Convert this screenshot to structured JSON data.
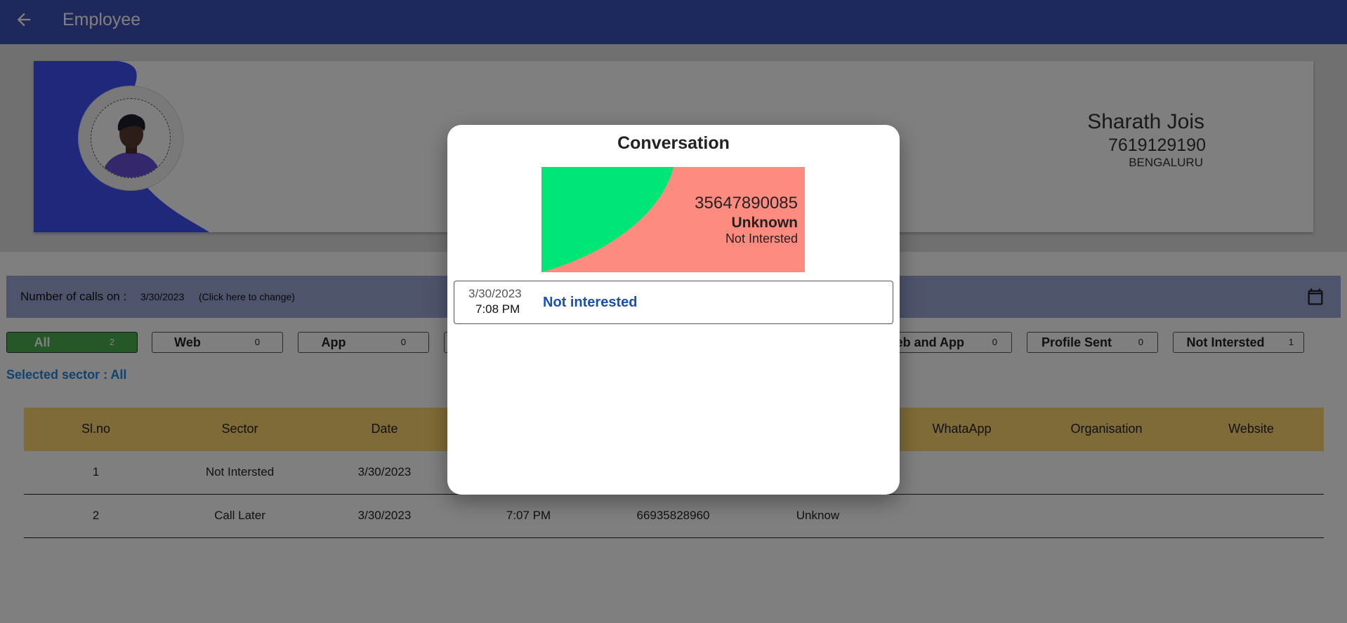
{
  "appbar": {
    "title": "Employee",
    "back_icon": "arrow-left-icon"
  },
  "profile": {
    "name": "Sharath Jois",
    "phone": "7619129190",
    "city": "BENGALURU"
  },
  "date_bar": {
    "label": "Number of calls on :",
    "date": "3/30/2023",
    "change_hint": "(Click here to change)",
    "calendar_icon": "calendar-icon"
  },
  "chips": [
    {
      "label": "All",
      "count": "2",
      "active": true
    },
    {
      "label": "Web",
      "count": "0"
    },
    {
      "label": "App",
      "count": "0"
    },
    {
      "label": "Web and App",
      "count": "0"
    },
    {
      "label": "Profile Sent",
      "count": "0"
    },
    {
      "label": "Not Intersted",
      "count": "1"
    }
  ],
  "selected_sector": "Selected sector : All",
  "table": {
    "headers": [
      "Sl.no",
      "Sector",
      "Date",
      "",
      "",
      "",
      "WhataApp",
      "Organisation",
      "Website"
    ],
    "rows": [
      {
        "slno": "1",
        "sector": "Not Intersted",
        "date": "3/30/2023",
        "time": "",
        "number": "",
        "name": ""
      },
      {
        "slno": "2",
        "sector": "Call Later",
        "date": "3/30/2023",
        "time": "7:07 PM",
        "number": "66935828960",
        "name": "Unknow"
      }
    ]
  },
  "dialog": {
    "title": "Conversation",
    "contact": {
      "number": "35647890085",
      "name": "Unknown",
      "status": "Not Intersted"
    },
    "messages": [
      {
        "date": "3/30/2023",
        "time": "7:08 PM",
        "text": "Not interested"
      }
    ]
  },
  "colors": {
    "appbar": "#3f51b5",
    "accent_green": "#00e676",
    "card_salmon": "#fe8b80",
    "table_header": "#ffd66e"
  }
}
